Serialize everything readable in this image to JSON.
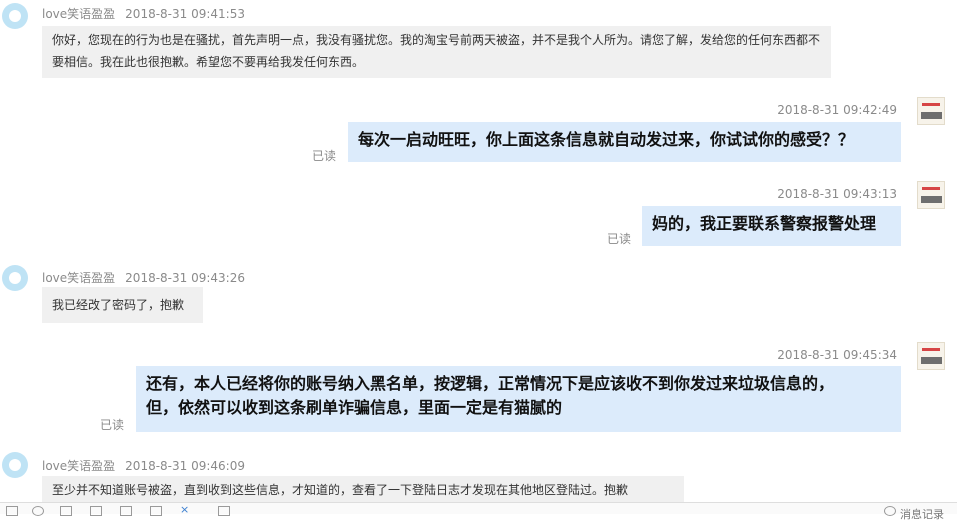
{
  "messages": [
    {
      "side": "left",
      "sender": "love笑语盈盈",
      "time": "2018-8-31 09:41:53",
      "text": "你好，您现在的行为也是在骚扰，首先声明一点，我没有骚扰您。我的淘宝号前两天被盗，并不是我个人所为。请您了解，发给您的任何东西都不要相信。我在此也很抱歉。希望您不要再给我发任何东西。"
    },
    {
      "side": "right",
      "time": "2018-8-31 09:42:49",
      "text": "每次一启动旺旺，你上面这条信息就自动发过来，你试试你的感受？？",
      "status": "已读"
    },
    {
      "side": "right",
      "time": "2018-8-31 09:43:13",
      "text": "妈的，我正要联系警察报警处理",
      "status": "已读"
    },
    {
      "side": "left",
      "sender": "love笑语盈盈",
      "time": "2018-8-31 09:43:26",
      "text": "我已经改了密码了，抱歉"
    },
    {
      "side": "right",
      "time": "2018-8-31 09:45:34",
      "text": "还有，本人已经将你的账号纳入黑名单，按逻辑，正常情况下是应该收不到你发过来垃圾信息的，但，依然可以收到这条刷单诈骗信息，里面一定是有猫腻的",
      "status": "已读"
    },
    {
      "side": "left",
      "sender": "love笑语盈盈",
      "time": "2018-8-31 09:46:09",
      "text": "至少并不知道账号被盗，直到收到这些信息，才知道的，查看了一下登陆日志才发现在其他地区登陆过。抱歉"
    }
  ],
  "toolbar": {
    "history_label": "消息记录"
  }
}
